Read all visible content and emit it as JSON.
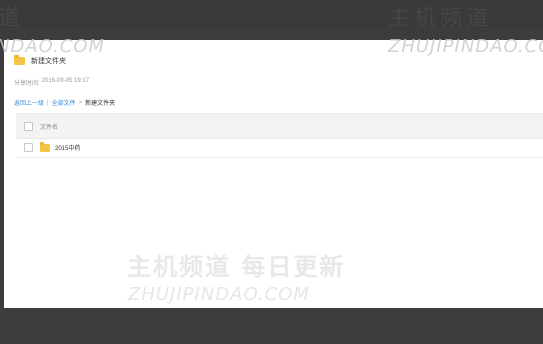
{
  "watermark": {
    "cn_top_left": "道",
    "cn_top_right": "主机频道",
    "en_top_left": "NDAO.COM",
    "en_top_right": "ZHUJIPINDAO.COM",
    "cn_center": "主机频道 每日更新",
    "en_center": "ZHUJIPINDAO.COM"
  },
  "share": {
    "folder_title": "新建文件夹",
    "time_label": "分享时间:",
    "time_value": "2016-09-05 19:17"
  },
  "breadcrumb": {
    "back": "返回上一级",
    "separator": "|",
    "all_files": "全部文件",
    "arrow": ">",
    "current": "新建文件夹"
  },
  "file_list": {
    "header_label": "文件名",
    "items": [
      {
        "name": "2015中药",
        "icon": "folder-icon"
      }
    ]
  },
  "colors": {
    "link": "#3b8cd9",
    "folder": "#f4c34a",
    "frame": "#3c3c3c"
  }
}
